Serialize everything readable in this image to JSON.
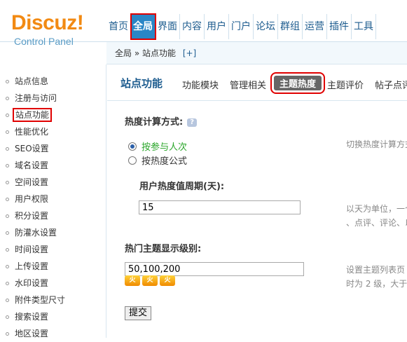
{
  "header": {
    "logo": "Discuz!",
    "logo_sub": "Control Panel",
    "nav": [
      "首页",
      "全局",
      "界面",
      "内容",
      "用户",
      "门户",
      "论坛",
      "群组",
      "运营",
      "插件",
      "工具"
    ]
  },
  "breadcrumb": {
    "path": "全局 » 站点功能",
    "plus": "[+]"
  },
  "sidebar": {
    "items": [
      "站点信息",
      "注册与访问",
      "站点功能",
      "性能优化",
      "SEO设置",
      "域名设置",
      "空间设置",
      "用户权限",
      "积分设置",
      "防灌水设置",
      "时间设置",
      "上传设置",
      "水印设置",
      "附件类型尺寸",
      "搜索设置",
      "地区设置"
    ],
    "active_index": 2
  },
  "tabs": {
    "title": "站点功能",
    "items": [
      "功能模块",
      "管理相关",
      "主题热度",
      "主题评价",
      "帖子点评"
    ],
    "active_index": 2
  },
  "form": {
    "calc_label": "热度计算方式:",
    "help": "?",
    "radio1": "按参与人次",
    "radio2": "按热度公式",
    "calc_hint": "切换热度计算方式",
    "period_label": "用户热度值周期(天):",
    "period_value": "15",
    "period_hint1": "以天为单位，一个",
    "period_hint2": "、点评、评论、以",
    "level_label": "热门主题显示级别:",
    "level_value": "50,100,200",
    "level_hint1": "设置主题列表页",
    "level_hint2": "时为 2 级，大于",
    "flames": [
      "火",
      "火",
      "火"
    ],
    "submit": "提交"
  }
}
